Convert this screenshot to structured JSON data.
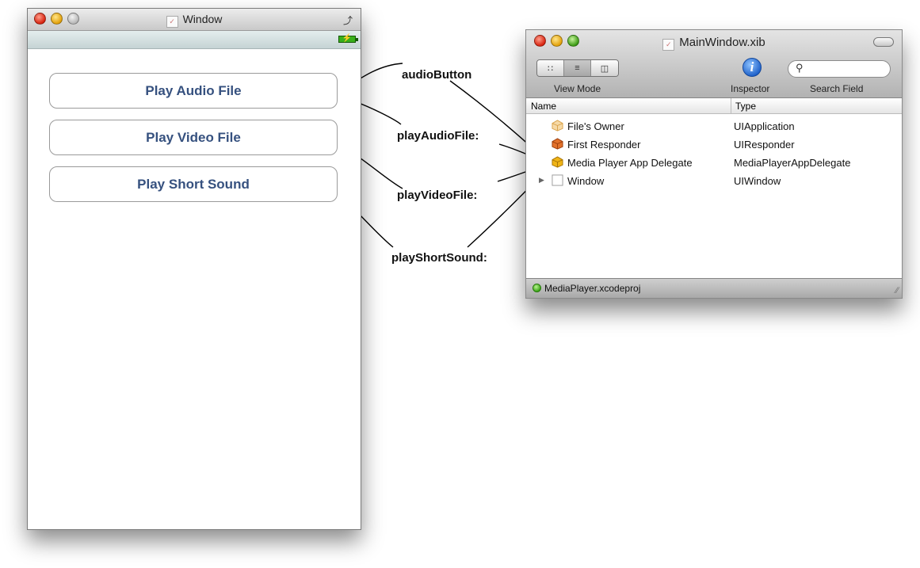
{
  "left_window": {
    "title": "Window",
    "buttons": [
      "Play Audio File",
      "Play Video File",
      "Play Short Sound"
    ]
  },
  "right_window": {
    "title": "MainWindow.xib",
    "toolbar": {
      "view_mode_label": "View Mode",
      "inspector_label": "Inspector",
      "search_label": "Search Field",
      "inspector_glyph": "i"
    },
    "columns": [
      "Name",
      "Type"
    ],
    "rows": [
      {
        "name": "File's Owner",
        "type": "UIApplication",
        "icon": "files-owner-cube-icon"
      },
      {
        "name": "First Responder",
        "type": "UIResponder",
        "icon": "first-responder-cube-icon"
      },
      {
        "name": "Media Player App Delegate",
        "type": "MediaPlayerAppDelegate",
        "icon": "app-delegate-cube-icon"
      },
      {
        "name": "Window",
        "type": "UIWindow",
        "icon": "window-icon"
      }
    ],
    "footer": "MediaPlayer.xcodeproj"
  },
  "connections": [
    "audioButton",
    "playAudioFile:",
    "playVideoFile:",
    "playShortSound:"
  ],
  "colors": {
    "button_text": "#36517f",
    "status_green": "#36a012",
    "battery": "#38b01b",
    "delegate_icon": "#f0b416",
    "responder_icon": "#d8601a"
  }
}
